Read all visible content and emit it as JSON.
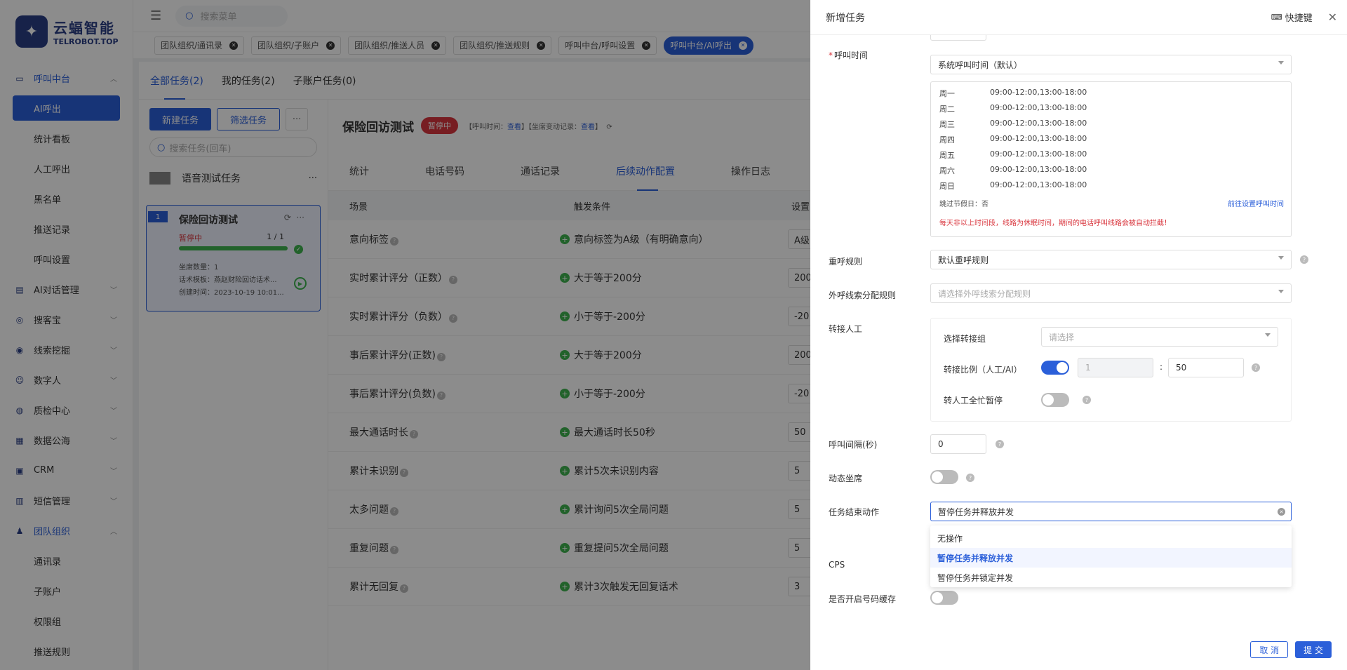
{
  "logo": {
    "cn": "云蝠智能",
    "en": "TELROBOT.TOP",
    "mark": "✦"
  },
  "topbar": {
    "search_placeholder": "搜索菜单"
  },
  "sidebar": {
    "groups": [
      {
        "label": "呼叫中台",
        "open": true,
        "icon": "monitor-icon",
        "children": [
          "AI呼出",
          "统计看板",
          "人工呼出",
          "黑名单",
          "推送记录",
          "呼叫设置"
        ]
      },
      {
        "label": "AI对话管理",
        "icon": "chat-icon"
      },
      {
        "label": "搜客宝",
        "icon": "search-icon"
      },
      {
        "label": "线索挖掘",
        "icon": "target-icon"
      },
      {
        "label": "数字人",
        "icon": "person-icon"
      },
      {
        "label": "质检中心",
        "icon": "quality-icon"
      },
      {
        "label": "数据公海",
        "icon": "data-icon"
      },
      {
        "label": "CRM",
        "icon": "crm-icon"
      },
      {
        "label": "短信管理",
        "icon": "sms-icon"
      },
      {
        "label": "团队组织",
        "open": true,
        "icon": "team-icon",
        "children": [
          "通讯录",
          "子账户",
          "权限组",
          "推送规则"
        ]
      }
    ]
  },
  "tags": [
    {
      "label": "团队组织/通讯录"
    },
    {
      "label": "团队组织/子账户"
    },
    {
      "label": "团队组织/推送人员"
    },
    {
      "label": "团队组织/推送规则"
    },
    {
      "label": "呼叫中台/呼叫设置"
    },
    {
      "label": "呼叫中台/AI呼出",
      "active": true
    }
  ],
  "content_tabs": [
    "全部任务(2)",
    "我的任务(2)",
    "子账户任务(0)"
  ],
  "left_pane": {
    "new_task": "新建任务",
    "filter_task": "筛选任务",
    "more": "···",
    "search_placeholder": "搜索任务(回车)",
    "group_name": "语音测试任务",
    "task": {
      "index": "1",
      "name": "保险回访测试",
      "status": "暂停中",
      "count": "1 / 1",
      "progress": 1.0,
      "seats": "坐席数量：1",
      "template": "话术模板：燕赵财险回访话术...",
      "created": "创建时间：2023-10-19 10:01..."
    }
  },
  "right_pane": {
    "title": "保险回访测试",
    "badge": "暂停中",
    "info_prefix1": "【呼叫时间：",
    "info_link1": "查看",
    "info_mid": "】【坐席变动记录：",
    "info_link2": "查看",
    "info_suffix": "】",
    "tabs": [
      "统计",
      "电话号码",
      "通话记录",
      "后续动作配置",
      "操作日志"
    ],
    "active_tab": 3,
    "columns": [
      "场景",
      "触发条件",
      "设置"
    ],
    "rows": [
      {
        "scene": "意向标签",
        "cond": "意向标签为A级（有明确意向）",
        "set": "A级"
      },
      {
        "scene": "实时累计评分（正数）",
        "cond": "大于等于200分",
        "set": "200"
      },
      {
        "scene": "实时累计评分（负数）",
        "cond": "小于等于-200分",
        "set": "-20"
      },
      {
        "scene": "事后累计评分(正数)",
        "cond": "大于等于200分",
        "set": "200"
      },
      {
        "scene": "事后累计评分(负数)",
        "cond": "小于等于-200分",
        "set": "-20"
      },
      {
        "scene": "最大通话时长",
        "cond": "最大通话时长50秒",
        "set": "50"
      },
      {
        "scene": "累计未识别",
        "cond": "累计5次未识别内容",
        "set": "5"
      },
      {
        "scene": "太多问题",
        "cond": "累计询问5次全局问题",
        "set": "5"
      },
      {
        "scene": "重复问题",
        "cond": "重复提问5次全局问题",
        "set": "5"
      },
      {
        "scene": "累计无回复",
        "cond": "累计3次触发无回复话术",
        "set": "3"
      }
    ]
  },
  "drawer": {
    "title": "新增任务",
    "shortcut": "快捷键",
    "call_time_label": "呼叫时间",
    "call_time_value": "系统呼叫时间（默认）",
    "schedule": [
      {
        "day": "周一",
        "time": "09:00-12:00,13:00-18:00"
      },
      {
        "day": "周二",
        "time": "09:00-12:00,13:00-18:00"
      },
      {
        "day": "周三",
        "time": "09:00-12:00,13:00-18:00"
      },
      {
        "day": "周四",
        "time": "09:00-12:00,13:00-18:00"
      },
      {
        "day": "周五",
        "time": "09:00-12:00,13:00-18:00"
      },
      {
        "day": "周六",
        "time": "09:00-12:00,13:00-18:00"
      },
      {
        "day": "周日",
        "time": "09:00-12:00,13:00-18:00"
      }
    ],
    "skip_holiday": "跳过节假日：否",
    "goto_set_time": "前往设置呼叫时间",
    "warning": "每天非以上时间段，线路为休眠时间，期间的电话呼叫线路会被自动拦截！",
    "redial_label": "重呼规则",
    "redial_value": "默认重呼规则",
    "lead_label": "外呼线索分配规则",
    "lead_placeholder": "请选择外呼线索分配规则",
    "transfer_label": "转接人工",
    "transfer_group_label": "选择转接组",
    "transfer_group_placeholder": "请选择",
    "ratio_label": "转接比例（人工/AI）",
    "ratio_human": "1",
    "ratio_sep": ":",
    "ratio_ai": "50",
    "busy_pause_label": "转人工全忙暂停",
    "interval_label": "呼叫间隔(秒)",
    "interval_value": "0",
    "dynamic_seat_label": "动态坐席",
    "end_action_label": "任务结束动作",
    "end_action_value": "暂停任务并释放并发",
    "end_action_options": [
      "无操作",
      "暂停任务并释放并发",
      "暂停任务并锁定并发"
    ],
    "cps_label": "CPS",
    "cache_label": "是否开启号码缓存",
    "cancel": "取 消",
    "submit": "提 交"
  },
  "colors": {
    "primary": "#2b5fd9",
    "danger": "#d9363e",
    "success": "#3fb34f"
  }
}
